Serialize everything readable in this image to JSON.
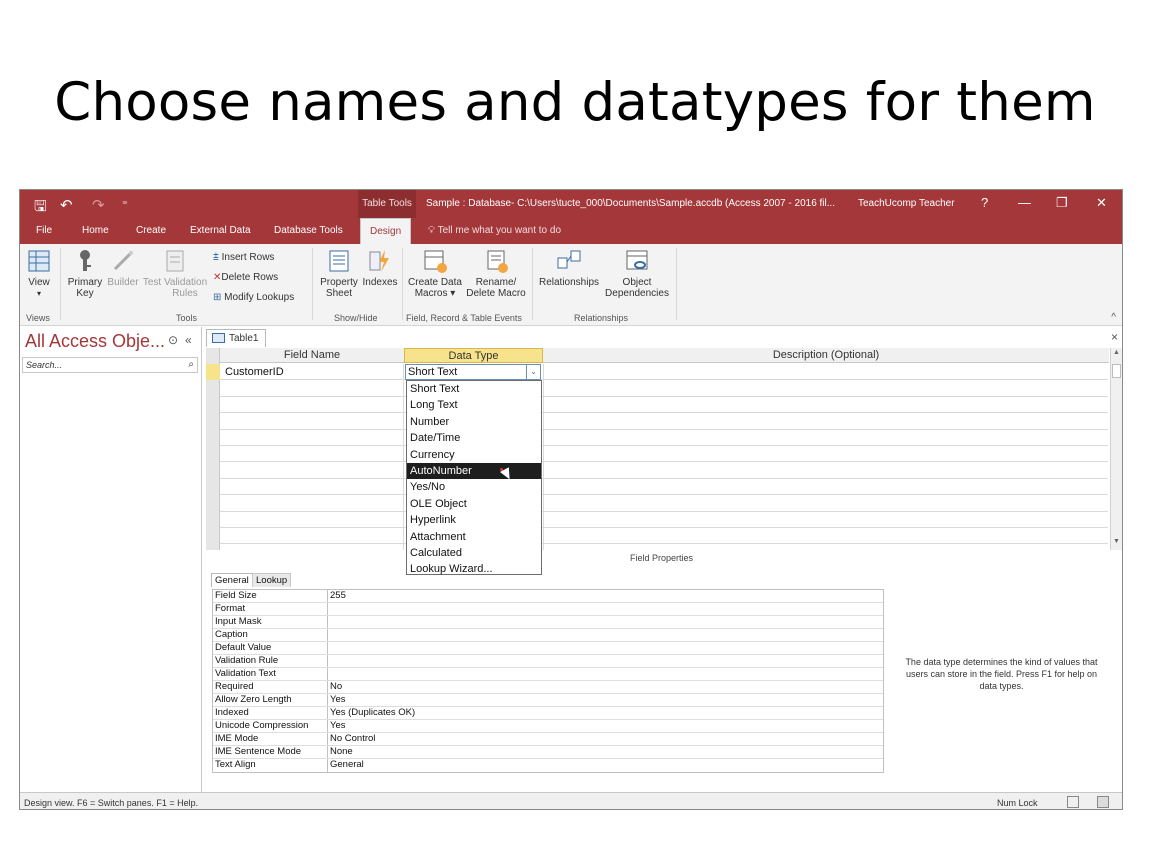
{
  "slide": {
    "title": "Choose names and datatypes for them"
  },
  "titlebar": {
    "context_tab": "Table Tools",
    "window_title": "Sample : Database- C:\\Users\\tucte_000\\Documents\\Sample.accdb (Access 2007 - 2016 fil...",
    "user": "TeachUcomp Teacher",
    "help": "?",
    "minimize": "—",
    "restore": "❐",
    "close": "✕",
    "save_glyph": "🖫",
    "undo_glyph": "↶",
    "redo_glyph": "↷",
    "customize_glyph": "⁼"
  },
  "tabs": [
    "File",
    "Home",
    "Create",
    "External Data",
    "Database Tools",
    "Design"
  ],
  "tell_me": "Tell me what you want to do",
  "ribbon": {
    "view": "View",
    "primary_key_1": "Primary",
    "primary_key_2": "Key",
    "builder": "Builder",
    "test_validation_1": "Test Validation",
    "test_validation_2": "Rules",
    "insert_rows": "Insert Rows",
    "delete_rows": "Delete Rows",
    "modify_lookups": "Modify Lookups",
    "property_sheet_1": "Property",
    "property_sheet_2": "Sheet",
    "indexes": "Indexes",
    "create_data_macros_1": "Create Data",
    "create_data_macros_2": "Macros ▾",
    "rename_delete_macro_1": "Rename/",
    "rename_delete_macro_2": "Delete Macro",
    "relationships": "Relationships",
    "object_dependencies_1": "Object",
    "object_dependencies_2": "Dependencies",
    "groups": [
      "Views",
      "Tools",
      "Show/Hide",
      "Field, Record & Table Events",
      "Relationships"
    ],
    "collapse": "^"
  },
  "nav": {
    "title": "All Access Obje...",
    "search_placeholder": "Search...",
    "menu_glyph": "⊙",
    "collapse_glyph": "«",
    "search_glyph": "⌕"
  },
  "doc": {
    "tab_label": "Table1",
    "close": "×",
    "columns": [
      "Field Name",
      "Data Type",
      "Description (Optional)"
    ],
    "rows": [
      {
        "field_name": "CustomerID",
        "data_type": "Short Text"
      }
    ],
    "dropdown_glyph": "⌄",
    "dropdown_options": [
      "Short Text",
      "Long Text",
      "Number",
      "Date/Time",
      "Currency",
      "AutoNumber",
      "Yes/No",
      "OLE Object",
      "Hyperlink",
      "Attachment",
      "Calculated",
      "Lookup Wizard..."
    ],
    "selected_option": "AutoNumber",
    "field_properties_label": "Field Properties"
  },
  "field_props": {
    "tabs": [
      "General",
      "Lookup"
    ],
    "rows": [
      {
        "label": "Field Size",
        "value": "255"
      },
      {
        "label": "Format",
        "value": ""
      },
      {
        "label": "Input Mask",
        "value": ""
      },
      {
        "label": "Caption",
        "value": ""
      },
      {
        "label": "Default Value",
        "value": ""
      },
      {
        "label": "Validation Rule",
        "value": ""
      },
      {
        "label": "Validation Text",
        "value": ""
      },
      {
        "label": "Required",
        "value": "No"
      },
      {
        "label": "Allow Zero Length",
        "value": "Yes"
      },
      {
        "label": "Indexed",
        "value": "Yes (Duplicates OK)"
      },
      {
        "label": "Unicode Compression",
        "value": "Yes"
      },
      {
        "label": "IME Mode",
        "value": "No Control"
      },
      {
        "label": "IME Sentence Mode",
        "value": "None"
      },
      {
        "label": "Text Align",
        "value": "General"
      }
    ],
    "help": "The data type determines the kind of values that users can store in the field. Press F1 for help on data types."
  },
  "status": {
    "left": "Design view.  F6 = Switch panes.  F1 = Help.",
    "num_lock": "Num Lock"
  },
  "colors": {
    "access_red": "#a4373a",
    "header_highlight": "#f6e38c",
    "selected_item": "#1e1e1e"
  }
}
